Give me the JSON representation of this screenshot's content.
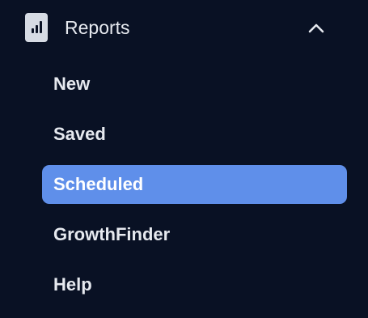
{
  "section": {
    "label": "Reports",
    "icon": "bar-chart-icon",
    "toggle_icon": "chevron-up-icon",
    "expanded": true
  },
  "items": [
    {
      "label": "New",
      "active": false
    },
    {
      "label": "Saved",
      "active": false
    },
    {
      "label": "Scheduled",
      "active": true
    },
    {
      "label": "GrowthFinder",
      "active": false
    },
    {
      "label": "Help",
      "active": false
    }
  ],
  "colors": {
    "background": "#091124",
    "active_item": "#5f8fea",
    "text": "#e6e9ef",
    "icon": "#d6dbe4"
  }
}
